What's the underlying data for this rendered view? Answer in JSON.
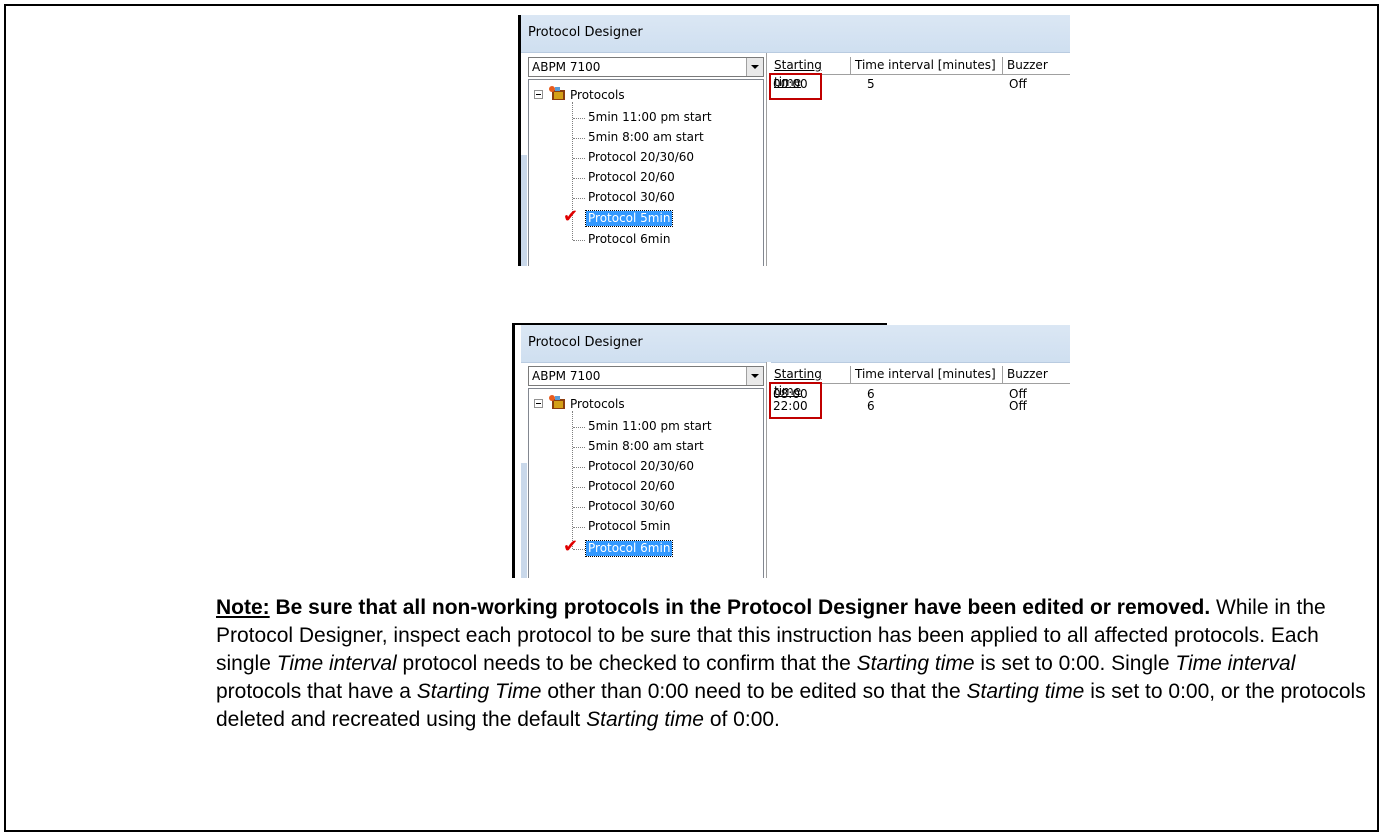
{
  "window1": {
    "title": "Protocol Designer",
    "device_select": "ABPM 7100",
    "tree_root": "Protocols",
    "tree_items": [
      "5min 11:00 pm start",
      "5min 8:00 am start",
      "Protocol 20/30/60",
      "Protocol 20/60",
      "Protocol 30/60",
      "Protocol 5min",
      "Protocol 6min"
    ],
    "columns": [
      "Starting time",
      "Time interval [minutes]",
      "Buzzer"
    ],
    "rows": [
      [
        "00:00",
        "5",
        "Off"
      ]
    ]
  },
  "window2": {
    "title": "Protocol Designer",
    "device_select": "ABPM 7100",
    "tree_root": "Protocols",
    "tree_items": [
      "5min 11:00 pm start",
      "5min 8:00 am start",
      "Protocol 20/30/60",
      "Protocol 20/60",
      "Protocol 30/60",
      "Protocol 5min",
      "Protocol 6min"
    ],
    "columns": [
      "Starting time",
      "Time interval [minutes]",
      "Buzzer"
    ],
    "rows": [
      [
        "08:00",
        "6",
        "Off"
      ],
      [
        "22:00",
        "6",
        "Off"
      ]
    ]
  },
  "note": {
    "label": "Note:",
    "bold": " Be sure that all non-working protocols in the Protocol Designer have been edited or removed.",
    "t1": "  While in the Protocol Designer, inspect each protocol to be sure that this instruction has been applied to all affected protocols.  Each single ",
    "i1": "Time interval",
    "t2": " protocol needs to be checked to confirm that the ",
    "i2": "Starting time",
    "t3": " is set to 0:00.  Single ",
    "i3": "Time interval",
    "t4": " protocols that have a ",
    "i4": "Starting Time",
    "t5": " other than 0:00 need to be edited so that the ",
    "i5": "Starting time",
    "t6": " is set to 0:00, or the protocols deleted and recreated using the default ",
    "i6": "Starting time",
    "t7": " of 0:00."
  }
}
